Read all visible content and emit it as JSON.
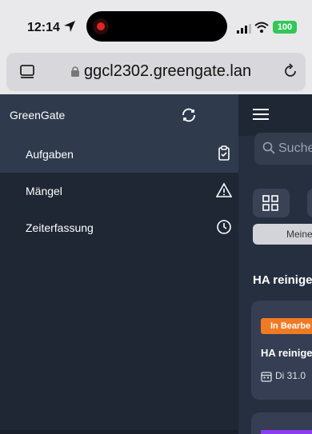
{
  "status_bar": {
    "time": "12:14",
    "battery": "100",
    "colors": {
      "battery": "#33c759",
      "record": "#e02424"
    }
  },
  "browser": {
    "url": "ggcl2302.greengate.lan"
  },
  "sidebar": {
    "title": "GreenGate",
    "items": [
      {
        "label": "Aufgaben",
        "icon": "clipboard-check-icon",
        "active": true
      },
      {
        "label": "Mängel",
        "icon": "warning-triangle-icon",
        "active": false
      },
      {
        "label": "Zeiterfassung",
        "icon": "clock-icon",
        "active": false
      }
    ]
  },
  "main": {
    "search_text": "Suche",
    "filter_label": "Meine",
    "section_heading": "HA reinige",
    "card": {
      "badge": "In Bearbe",
      "title": "HA reinige",
      "date": "Di 31.0"
    },
    "colors": {
      "badge": "#f07a24",
      "next_badge": "#8b3df0"
    }
  }
}
